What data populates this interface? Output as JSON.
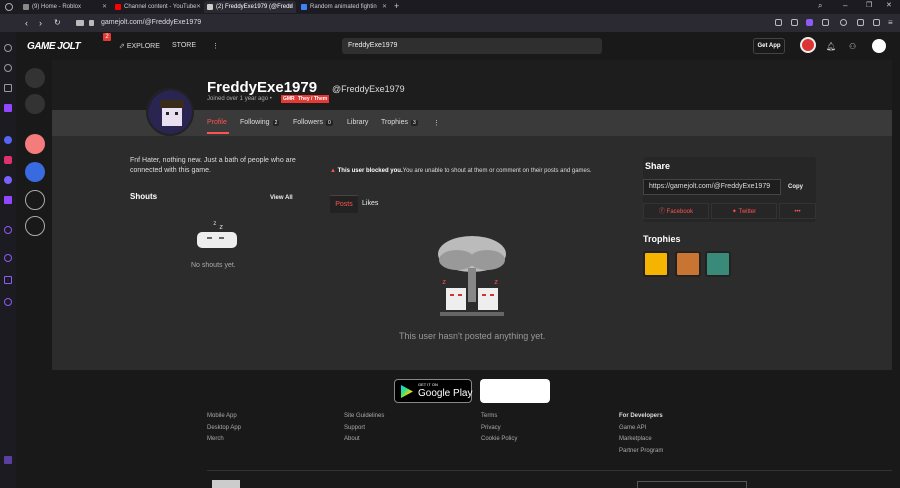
{
  "browser": {
    "tabs": [
      {
        "label": "(9) Home - Roblox",
        "color": "#888888"
      },
      {
        "label": "Channel content - YouTube",
        "color": "#ff0000"
      },
      {
        "label": "(2) FreddyExe1979 (@Fredd",
        "color": "#cccccc"
      },
      {
        "label": "Random animated fightin",
        "color": "#3b82f6"
      }
    ],
    "new_tab": "+",
    "url": "gamejolt.com/@FreddyExe1979"
  },
  "nav": {
    "logo": "GAME JOLT",
    "logo_badge": "2",
    "explore": "EXPLORE",
    "store": "STORE",
    "more": "⋮",
    "search_value": "FreddyExe1979",
    "get_app": "Get App"
  },
  "profile": {
    "display_name": "FreddyExe1979",
    "handle": "@FreddyExe1979",
    "joined": "Joined over 1 year ago",
    "dot": "•",
    "badge1": "GMR",
    "badge2": "They / Them",
    "tabs": {
      "profile": "Profile",
      "following": "Following",
      "following_count": "2",
      "followers": "Followers",
      "followers_count": "0",
      "library": "Library",
      "trophies": "Trophies",
      "trophies_count": "3",
      "more": "⋮"
    },
    "bio": "Fnf Hater, nothing new. Just a bath of people who are connected with this game."
  },
  "shouts": {
    "title": "Shouts",
    "view_all": "View All",
    "empty": "No shouts yet."
  },
  "feed": {
    "blocked_bold": "This user blocked you.",
    "blocked_rest": "You are unable to shout at them or comment on their posts and games.",
    "posts_tab": "Posts",
    "likes_tab": "Likes",
    "empty": "This user hasn't posted anything yet."
  },
  "share": {
    "title": "Share",
    "url": "https://gamejolt.com/@FreddyExe1979",
    "copy": "Copy",
    "facebook": "Facebook",
    "twitter": "Twitter",
    "more": "•••"
  },
  "trophies": {
    "title": "Trophies",
    "items": [
      {
        "icon": "smiley-trophy-icon",
        "color": "#f4b400"
      },
      {
        "icon": "number-one-trophy-icon",
        "color": "#c87533"
      },
      {
        "icon": "robot-trophy-icon",
        "color": "#3a8a7a"
      }
    ]
  },
  "footer": {
    "google_small": "GET IT ON",
    "google_big": "Google Play",
    "col1": [
      "Mobile App",
      "Desktop App",
      "Merch"
    ],
    "col2": [
      "Site Guidelines",
      "Support",
      "About"
    ],
    "col3": [
      "Terms",
      "Privacy",
      "Cookie Policy"
    ],
    "col4_head": "For Developers",
    "col4": [
      "Game API",
      "Marketplace",
      "Partner Program"
    ]
  }
}
